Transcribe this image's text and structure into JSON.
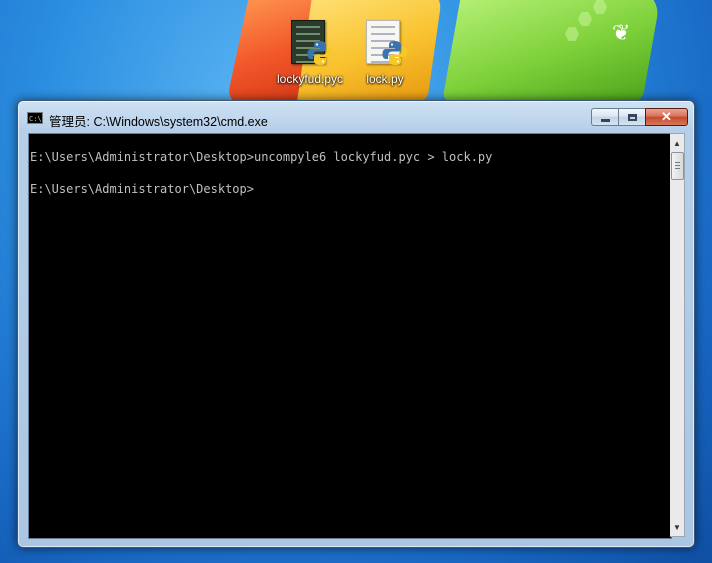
{
  "desktop": {
    "icons": [
      {
        "label": "lockyfud.pyc",
        "icon": "python-compiled-file-icon"
      },
      {
        "label": "lock.py",
        "icon": "python-file-icon"
      }
    ],
    "colors": {
      "flag_red": "#f2582a",
      "flag_yellow": "#f9c22e",
      "flag_green": "#7ed13a",
      "sky": "#2b8ee0"
    }
  },
  "window": {
    "title": "管理员: C:\\Windows\\system32\\cmd.exe",
    "app_icon": "cmd-icon",
    "app_icon_text": "C:\\",
    "buttons": {
      "minimize": "minimize-icon",
      "maximize": "maximize-icon",
      "close": "close-icon",
      "close_glyph": "✕"
    },
    "console": {
      "background": "#000000",
      "foreground": "#c0c0c0",
      "text": "E:\\Users\\Administrator\\Desktop>uncompyle6 lockyfud.pyc > lock.py\n\nE:\\Users\\Administrator\\Desktop>"
    },
    "scrollbar": {
      "up": "▲",
      "down": "▼"
    }
  }
}
